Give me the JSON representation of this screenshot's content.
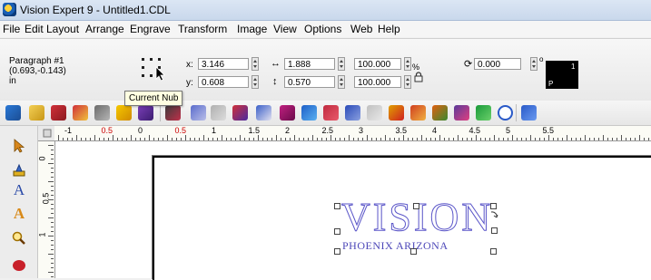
{
  "window": {
    "title": "Vision Expert 9  - Untitled1.CDL"
  },
  "menu": [
    "File",
    "Edit",
    "Layout",
    "Arrange",
    "Engrave",
    "Transform",
    "Image",
    "View",
    "Options",
    "Web",
    "Help"
  ],
  "object_info": {
    "name": "Paragraph #1",
    "coords": "(0.693,-0.143)",
    "units": "in"
  },
  "tooltip": "Current Nub",
  "position": {
    "x_label": "x:",
    "x_value": "3.146",
    "y_label": "y:",
    "y_value": "0.608"
  },
  "size": {
    "w_value": "1.888",
    "h_value": "0.570"
  },
  "scale": {
    "x_value": "100.000",
    "y_value": "100.000",
    "unit": "%"
  },
  "rotation": {
    "value": "0.000",
    "unit": "o"
  },
  "color_swatch": {
    "color": "#000000",
    "number": "1",
    "mode": "P"
  },
  "ruler_h_labels": [
    "-1",
    "0.5",
    "0",
    "0.5",
    "1",
    "1.5",
    "2",
    "2.5",
    "3",
    "3.5",
    "4",
    "4.5",
    "5",
    "5.5"
  ],
  "ruler_v_labels": [
    "0",
    "0.5",
    "1"
  ],
  "canvas_text": {
    "main": "VISION",
    "sub": "PHOENIX ARIZONA",
    "color": "#5a55c8"
  }
}
